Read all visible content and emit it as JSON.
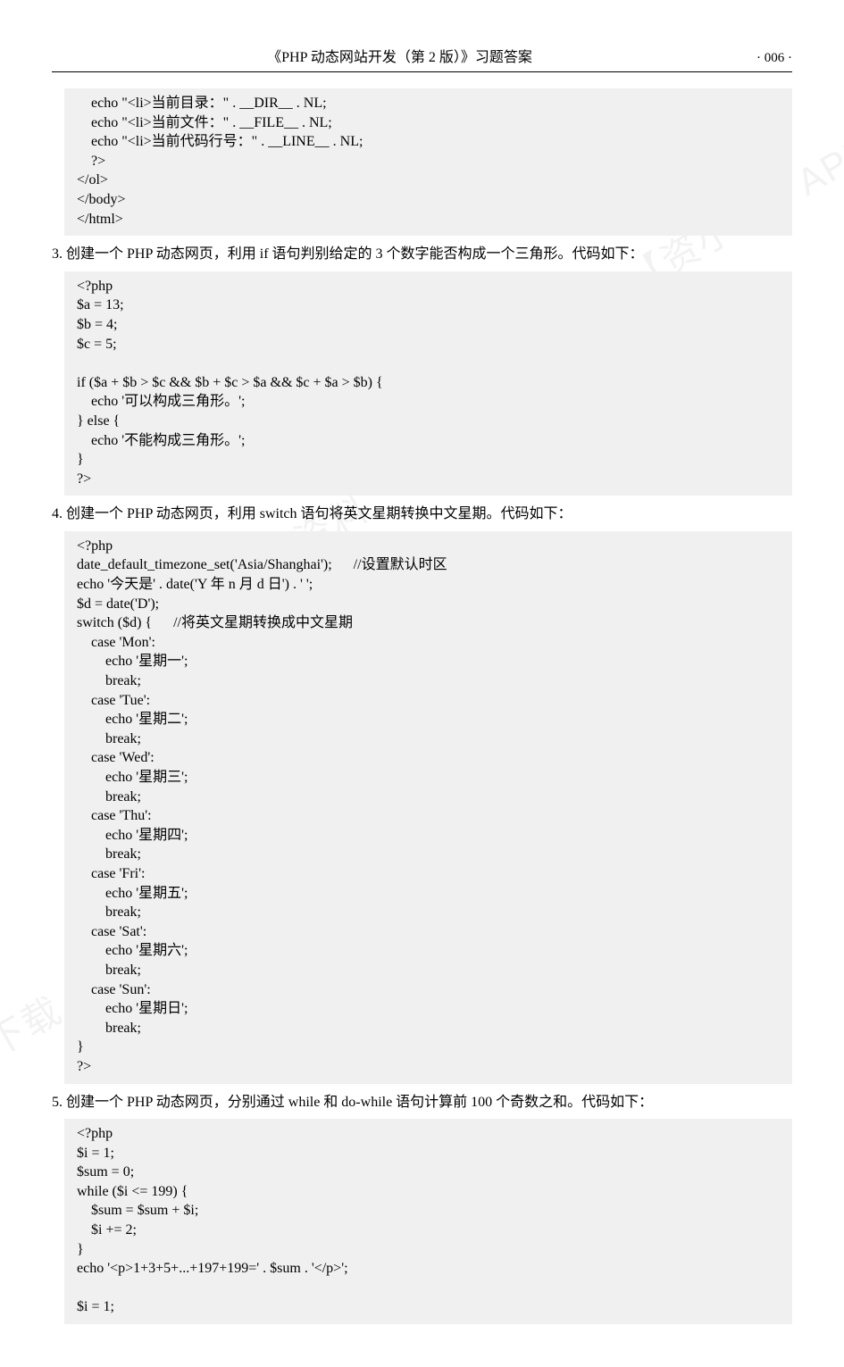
{
  "header": {
    "title": "《PHP 动态网站开发（第 2 版）》习题答案",
    "page": "· 006 ·"
  },
  "watermarks": {
    "w1": "查看完整学习资料",
    "w2": "请下载【资小料】APP"
  },
  "code1": "    echo \"<li>当前目录：\" . __DIR__ . NL;\n    echo \"<li>当前文件：\" . __FILE__ . NL;\n    echo \"<li>当前代码行号：\" . __LINE__ . NL;\n    ?>\n</ol>\n</body>\n</html>",
  "q3": "3. 创建一个 PHP 动态网页，利用 if 语句判别给定的 3 个数字能否构成一个三角形。代码如下：",
  "code3": "<?php\n$a = 13;\n$b = 4;\n$c = 5;\n\nif ($a + $b > $c && $b + $c > $a && $c + $a > $b) {\n    echo '可以构成三角形。';\n} else {\n    echo '不能构成三角形。';\n}\n?>",
  "q4": "4. 创建一个 PHP 动态网页，利用 switch 语句将英文星期转换中文星期。代码如下：",
  "code4": "<?php\ndate_default_timezone_set('Asia/Shanghai');      //设置默认时区\necho '今天是' . date('Y 年 n 月 d 日') . ' ';\n$d = date('D');\nswitch ($d) {      //将英文星期转换成中文星期\n    case 'Mon':\n        echo '星期一';\n        break;\n    case 'Tue':\n        echo '星期二';\n        break;\n    case 'Wed':\n        echo '星期三';\n        break;\n    case 'Thu':\n        echo '星期四';\n        break;\n    case 'Fri':\n        echo '星期五';\n        break;\n    case 'Sat':\n        echo '星期六';\n        break;\n    case 'Sun':\n        echo '星期日';\n        break;\n}\n?>",
  "q5": "5. 创建一个 PHP 动态网页，分别通过 while 和 do-while 语句计算前 100 个奇数之和。代码如下：",
  "code5": "<?php\n$i = 1;\n$sum = 0;\nwhile ($i <= 199) {\n    $sum = $sum + $i;\n    $i += 2;\n}\necho '<p>1+3+5+...+197+199=' . $sum . '</p>';\n\n$i = 1;"
}
